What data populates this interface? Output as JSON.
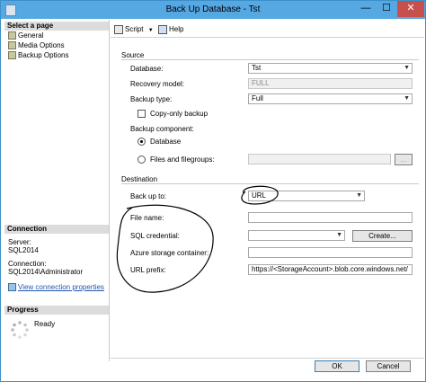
{
  "window": {
    "title": "Back Up Database - Tst",
    "controls": {
      "minimize": "—",
      "maximize": "☐",
      "close": "✕"
    }
  },
  "sidebar": {
    "select_page_title": "Select a page",
    "pages": [
      {
        "label": "General",
        "icon": "page-icon"
      },
      {
        "label": "Media Options",
        "icon": "page-icon"
      },
      {
        "label": "Backup Options",
        "icon": "page-icon"
      }
    ],
    "connection_title": "Connection",
    "server_label": "Server:",
    "server_value": "SQL2014",
    "connection_label": "Connection:",
    "connection_value": "SQL2014\\Administrator",
    "view_connection_link": "View connection properties",
    "progress_title": "Progress",
    "progress_status": "Ready"
  },
  "toolbar": {
    "script_label": "Script",
    "script_dropdown": "▼",
    "help_label": "Help"
  },
  "source": {
    "title": "Source",
    "database_label": "Database:",
    "database_value": "Tst",
    "recovery_label": "Recovery model:",
    "recovery_value": "FULL",
    "backup_type_label": "Backup type:",
    "backup_type_value": "Full",
    "copy_only_label": "Copy-only backup",
    "component_label": "Backup component:",
    "component_database": "Database",
    "component_files": "Files and filegroups:",
    "files_browse": "..."
  },
  "destination": {
    "title": "Destination",
    "backup_to_label": "Back up to:",
    "backup_to_value": "URL",
    "file_name_label": "File name:",
    "sql_credential_label": "SQL credential:",
    "create_button": "Create...",
    "azure_container_label": "Azure storage container:",
    "url_prefix_label": "URL prefix:",
    "url_prefix_value": "https://<StorageAccount>.blob.core.windows.net/"
  },
  "buttons": {
    "ok": "OK",
    "cancel": "Cancel"
  },
  "colors": {
    "titlebar": "#56a8e3",
    "close_button": "#c7504f",
    "link": "#1f57b5",
    "annotation": "#000000"
  }
}
